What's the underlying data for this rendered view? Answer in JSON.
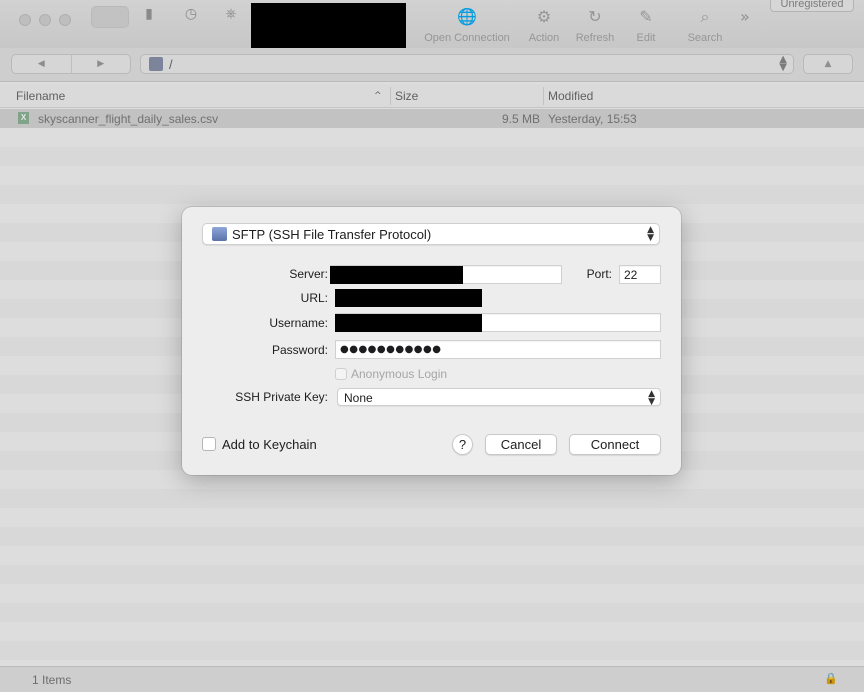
{
  "toolbar": {
    "buttons": [
      {
        "label": "Open Connection",
        "icon": "globe-plus-icon"
      },
      {
        "label": "Action",
        "icon": "gear-icon"
      },
      {
        "label": "Refresh",
        "icon": "refresh-icon"
      },
      {
        "label": "Edit",
        "icon": "pencil-icon"
      },
      {
        "label": "Search",
        "icon": "search-icon"
      }
    ],
    "unregistered_label": "Unregistered"
  },
  "navigation": {
    "path": "/"
  },
  "file_list": {
    "columns": [
      "Filename",
      "Size",
      "Modified"
    ],
    "rows": [
      {
        "filename": "skyscanner_flight_daily_sales.csv",
        "size": "9.5 MB",
        "modified": "Yesterday, 15:53"
      }
    ]
  },
  "status_bar": {
    "item_count": "1 Items"
  },
  "connection_sheet": {
    "protocol": "SFTP (SSH File Transfer Protocol)",
    "server_label": "Server:",
    "port_label": "Port:",
    "port_value": "22",
    "url_label": "URL:",
    "username_label": "Username:",
    "password_label": "Password:",
    "password_value": "●●●●●●●●●●●",
    "anonymous_login_label": "Anonymous Login",
    "ssh_key_label": "SSH Private Key:",
    "ssh_key_value": "None",
    "add_to_keychain_label": "Add to Keychain",
    "help_label": "?",
    "cancel_label": "Cancel",
    "connect_label": "Connect"
  }
}
